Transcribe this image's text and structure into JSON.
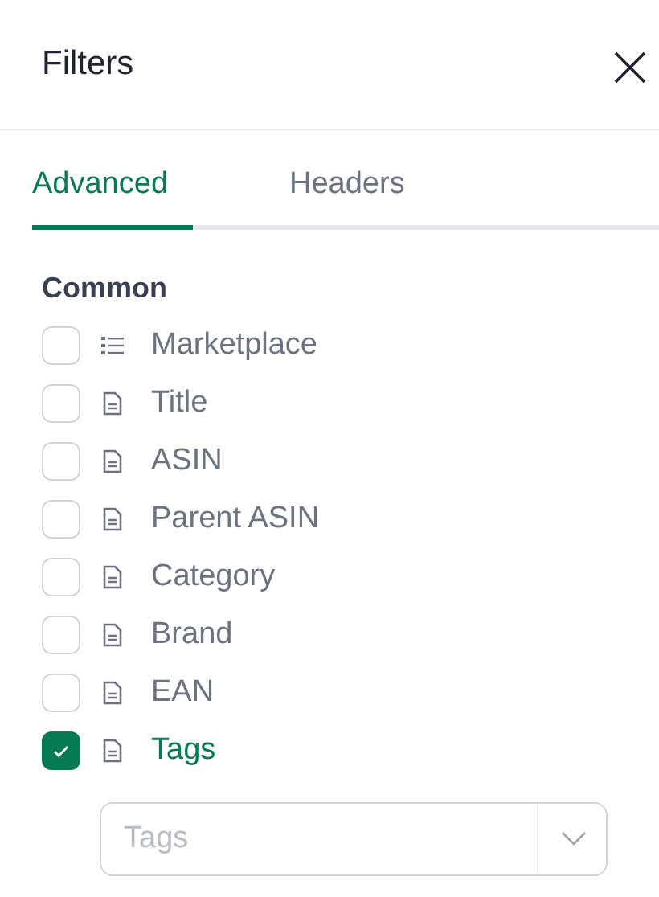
{
  "panel": {
    "title": "Filters"
  },
  "tabs": [
    {
      "label": "Advanced",
      "selected": true
    },
    {
      "label": "Headers",
      "selected": false
    }
  ],
  "section": {
    "title": "Common",
    "items": [
      {
        "label": "Marketplace",
        "kind": "list",
        "checked": false
      },
      {
        "label": "Title",
        "kind": "document",
        "checked": false
      },
      {
        "label": "ASIN",
        "kind": "document",
        "checked": false
      },
      {
        "label": "Parent ASIN",
        "kind": "document",
        "checked": false
      },
      {
        "label": "Category",
        "kind": "document",
        "checked": false
      },
      {
        "label": "Brand",
        "kind": "document",
        "checked": false
      },
      {
        "label": "EAN",
        "kind": "document",
        "checked": false
      },
      {
        "label": "Tags",
        "kind": "document",
        "checked": true,
        "select": {
          "placeholder": "Tags"
        }
      }
    ]
  }
}
